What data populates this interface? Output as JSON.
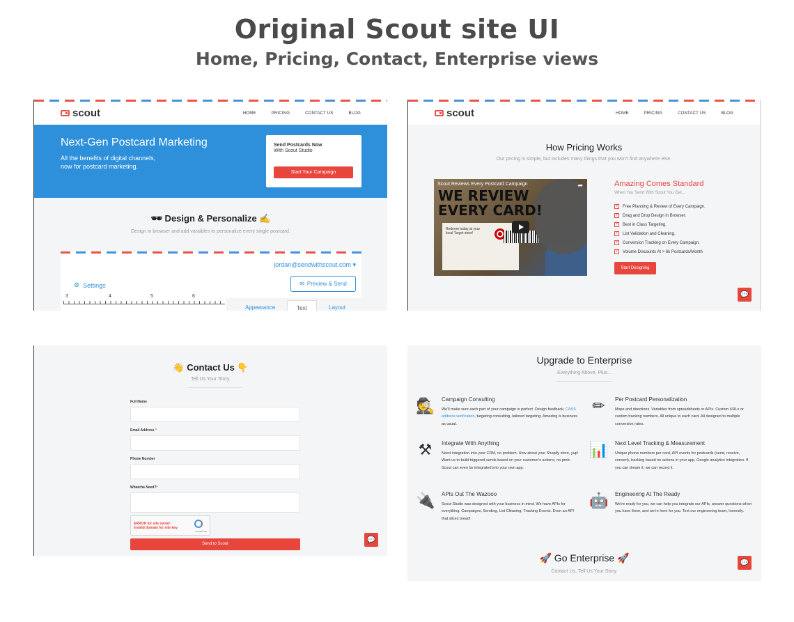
{
  "header": {
    "title": "Original Scout site UI",
    "subtitle": "Home, Pricing, Contact, Enterprise views"
  },
  "brand": {
    "name": "scout",
    "accent_color": "#e8453c",
    "blue_color": "#2e90db"
  },
  "nav": {
    "items": [
      "HOME",
      "PRICING",
      "CONTACT US",
      "BLOG"
    ]
  },
  "home": {
    "hero_title": "Next-Gen Postcard Marketing",
    "hero_sub_line1": "All the benefits of digital channels,",
    "hero_sub_line2": "now for postcard marketing.",
    "card_title": "Send Postcards Now",
    "card_sub": "With Scout Studio",
    "card_button": "Start Your Campaign",
    "section_title": "🕶 Design & Personalize ✍",
    "section_sub": "Design in browser and add varaibles to personalize every single postcard.",
    "editor": {
      "email": "jordan@sendwithscout.com ▾",
      "settings_label": "Settings",
      "preview_button": "Preview & Send",
      "ruler_marks": [
        "3",
        "4",
        "5",
        "6"
      ],
      "tabs": [
        "Appearance",
        "Text",
        "Layout"
      ]
    }
  },
  "pricing": {
    "title": "How Pricing Works",
    "subtitle": "Our pricing is simple, but includes many things that you won't find anywhere else.",
    "video": {
      "header": "Scout Reviews Every Postcard Campaign",
      "headline_line1": "WE REVIEW",
      "headline_line2": "EVERY CARD!",
      "card_text": "Redeem today at your local Target store!",
      "card_brand": "TARGET"
    },
    "amazing_title": "Amazing Comes Standard",
    "amazing_sub": "When You Send With Scout You Get...",
    "features": [
      "Free Planning & Review of Every Campaign.",
      "Drag and Drop Design in Browser.",
      "Best in Class Targeting.",
      "List Validation and Cleaning.",
      "Conversion Tracking on Every Campaign.",
      "Volume Discounts At > 6k Postcards/Month"
    ],
    "button": "Start Designing"
  },
  "contact": {
    "title": "👋 Contact Us 👇",
    "subtitle": "Tell Us Your Story.",
    "fields": [
      {
        "label": "Full Name",
        "required": ""
      },
      {
        "label": "Email Address ",
        "required": "*"
      },
      {
        "label": "Phone Number",
        "required": ""
      },
      {
        "label": "Whatcha Need?",
        "required": "*"
      }
    ],
    "recaptcha_error_line1": "ERROR for site owner:",
    "recaptcha_error_line2": "Invalid domain for site key",
    "recaptcha_brand": "reCAPTCHA",
    "button": "Send to Scout"
  },
  "enterprise": {
    "title": "Upgrade to Enterprise",
    "subtitle": "Everything Above, Plus...",
    "features": [
      {
        "icon": "🕵",
        "title": "Campaign Consulting",
        "desc_before": "We'll make sure each part of your campaign is perfect. Design feedback, ",
        "link": "CASS address verification",
        "desc_after": ", targeting consulting, tailored targeting. Amazing is business as usual."
      },
      {
        "icon": "✏",
        "title": "Per Postcard Personalization",
        "desc_before": "Maps and directions. Variables from spreadsheets or APIs. Custom URLs or custom tracking numbers. All unique to each card. All designed to multiple conversion rates.",
        "link": "",
        "desc_after": ""
      },
      {
        "icon": "⚒",
        "title": "Integrate With Anything",
        "desc_before": "Need integration into your CRM, no problem. How about your Shopify store, yup! Want us to build triggered sends based on your customer's actions, no prob. Scout can even be integrated into your own app.",
        "link": "",
        "desc_after": ""
      },
      {
        "icon": "📊",
        "title": "Next Level Tracking & Measurement",
        "desc_before": "Unique phone numbers per card, API events for postcards (send, receive, convert), tracking based on actions in your app, Google analytics integration. If you can dream it, we can record it.",
        "link": "",
        "desc_after": ""
      },
      {
        "icon": "🔌",
        "title": "APIs Out The Wazooo",
        "desc_before": "Scout Studio was designed with your business in mind. We have APIs for everything. Campaigns, Sending, List Cleaning, Tracking Events. Even an API that slices bread!",
        "link": "",
        "desc_after": ""
      },
      {
        "icon": "🤖",
        "title": "Engineering At The Ready",
        "desc_before": "We're ready for you, we can help you integrate our APIs, answer questions when you have them, and we're here for you. Text our engineering team, honestly.",
        "link": "",
        "desc_after": ""
      }
    ],
    "go_title": "🚀 Go Enterprise 🚀",
    "go_sub": "Contact Us, Tell Us Your Story."
  }
}
